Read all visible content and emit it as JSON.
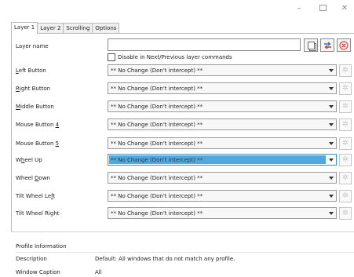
{
  "window": {
    "minimize_glyph": "–",
    "close_glyph": "✕"
  },
  "tabs": [
    {
      "label": "Layer 1",
      "active": true
    },
    {
      "label": "Layer 2",
      "active": false
    },
    {
      "label": "Scrolling",
      "active": false
    },
    {
      "label": "Options",
      "active": false
    }
  ],
  "layer_name": {
    "label": "Layer name",
    "value": ""
  },
  "disable_next_prev": {
    "label": "Disable in Next/Previous layer commands",
    "checked": false
  },
  "mappings": [
    {
      "pre": "",
      "key": "L",
      "post": "eft Button",
      "value": "** No Change (Don't intercept) **"
    },
    {
      "pre": "",
      "key": "R",
      "post": "ight Button",
      "value": "** No Change (Don't intercept) **"
    },
    {
      "pre": "",
      "key": "M",
      "post": "iddle Button",
      "value": "** No Change (Don't intercept) **"
    },
    {
      "pre": "Mouse Button ",
      "key": "4",
      "post": "",
      "value": "** No Change (Don't intercept) **"
    },
    {
      "pre": "Mouse Button ",
      "key": "5",
      "post": "",
      "value": "** No Change (Don't intercept) **"
    },
    {
      "pre": "W",
      "key": "h",
      "post": "eel Up",
      "value": "** No Change (Don't intercept) **"
    },
    {
      "pre": "Wheel ",
      "key": "D",
      "post": "own",
      "value": "** No Change (Don't intercept) **"
    },
    {
      "pre": "Tilt Wheel Le",
      "key": "f",
      "post": "t",
      "value": "** No Change (Don't intercept) **"
    },
    {
      "pre": "Tilt Wheel Right",
      "key": "",
      "post": "",
      "value": "** No Change (Don't intercept) **"
    }
  ],
  "gear_glyph": "✲",
  "profile_info": {
    "heading": "Profile Information",
    "description_label": "Description",
    "description_value": "Default: All windows that do not match any profile.",
    "caption_label": "Window Caption",
    "caption_value": "All"
  },
  "colors": {
    "accent": "#3399d6",
    "delete_icon": "#d9534f",
    "swap_icon": "#2b78c2"
  }
}
